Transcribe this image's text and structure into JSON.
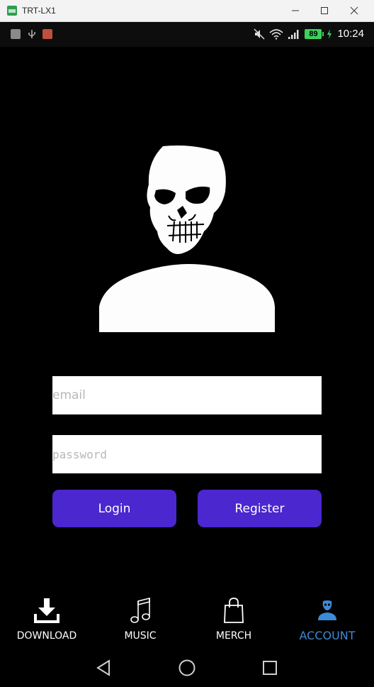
{
  "window": {
    "title": "TRT-LX1"
  },
  "statusbar": {
    "battery": "89",
    "time": "10:24"
  },
  "form": {
    "email_placeholder": "email",
    "password_placeholder": "password",
    "login_label": "Login",
    "register_label": "Register"
  },
  "bottom_nav": {
    "items": [
      {
        "label": "DOWNLOAD",
        "icon": "download-icon"
      },
      {
        "label": "MUSIC",
        "icon": "music-note-icon"
      },
      {
        "label": "MERCH",
        "icon": "shopping-bag-icon"
      },
      {
        "label": "ACCOUNT",
        "icon": "account-icon",
        "active": true
      }
    ]
  },
  "colors": {
    "primary_button": "#4a27cf",
    "active_nav": "#3d8ad6",
    "background": "#000000"
  }
}
